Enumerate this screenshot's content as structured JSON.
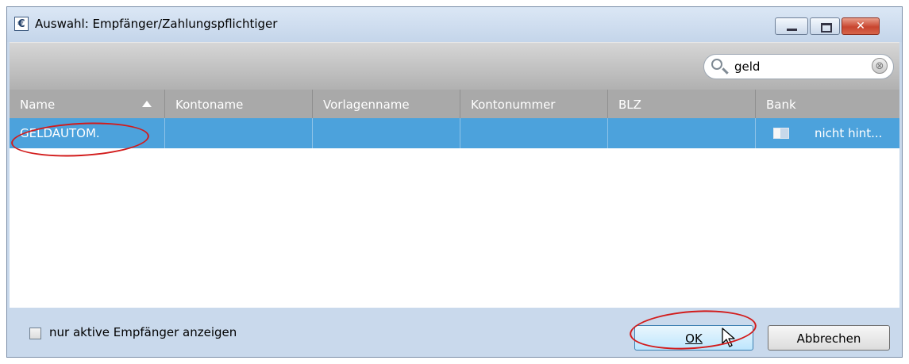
{
  "window": {
    "title": "Auswahl: Empfänger/Zahlungspflichtiger",
    "icon": "euro-icon",
    "close_glyph": "✕"
  },
  "search": {
    "value": "geld",
    "clear_glyph": "⊗"
  },
  "table": {
    "columns": [
      "Name",
      "Kontoname",
      "Vorlagenname",
      "Kontonummer",
      "BLZ",
      "Bank"
    ],
    "sort_column": "Name",
    "sort_direction": "ascending",
    "rows": [
      {
        "name": "GELDAUTOM.",
        "kontoname": "",
        "vorlagenname": "",
        "kontonummer": "",
        "blz": "",
        "bank": "nicht hint..."
      }
    ]
  },
  "footer": {
    "checkbox_label": "nur aktive Empfänger anzeigen",
    "checkbox_checked": false,
    "ok_label": "OK",
    "cancel_label": "Abbrechen"
  },
  "colors": {
    "selection": "#4ca2dc",
    "header": "#a9a9a9",
    "annotation": "#d21b1b"
  }
}
